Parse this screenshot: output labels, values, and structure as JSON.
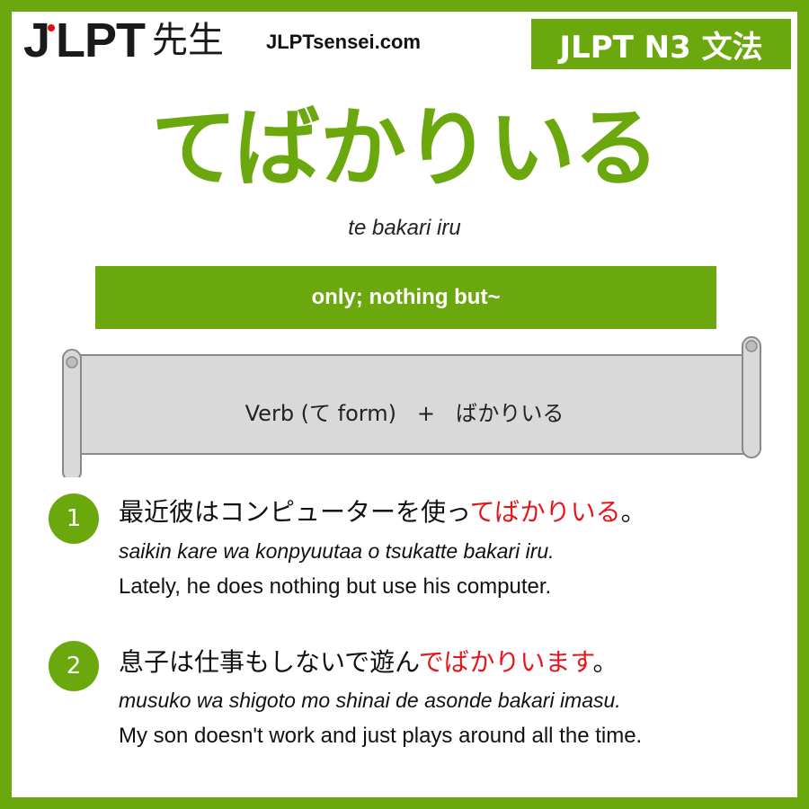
{
  "brand": {
    "logo_j": "J",
    "logo_lpt": "LPT",
    "logo_sensei": "先生",
    "site": "JLPTsensei.com"
  },
  "badge": "JLPT N3 文法",
  "title": "てばかりいる",
  "romaji": "te bakari iru",
  "meaning": "only; nothing but~",
  "formula": "Verb (て form)   +   ばかりいる",
  "examples": [
    {
      "number": "1",
      "jp_before": "最近彼はコンピューターを使っ",
      "jp_highlight": "てばかりいる",
      "jp_after": "。",
      "romaji": "saikin kare wa konpyuutaa o tsukatte bakari iru.",
      "english": "Lately, he does nothing but use his computer."
    },
    {
      "number": "2",
      "jp_before": "息子は仕事もしないで遊ん",
      "jp_highlight": "でばかりいます",
      "jp_after": "。",
      "romaji": "musuko wa shigoto mo shinai de asonde bakari imasu.",
      "english": "My son doesn't work and just plays around all the time."
    }
  ],
  "colors": {
    "accent": "#6aa80e",
    "highlight": "#e4161c",
    "logo_dot": "#e10c0c",
    "scroll_fill": "#d9d9d9"
  }
}
